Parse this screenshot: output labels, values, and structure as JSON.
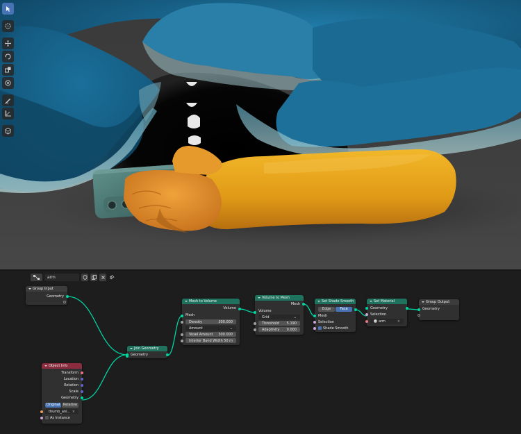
{
  "viewport": {
    "toolbar": [
      {
        "icon": "select-box-icon",
        "active": true
      },
      {
        "icon": "cursor-icon",
        "active": false
      },
      {
        "icon": "move-icon",
        "active": false
      },
      {
        "icon": "rotate-icon",
        "active": false
      },
      {
        "icon": "scale-icon",
        "active": false
      },
      {
        "icon": "transform-icon",
        "active": false
      },
      {
        "icon": "annotate-icon",
        "active": false
      },
      {
        "icon": "measure-icon",
        "active": false
      },
      {
        "icon": "add-cube-icon",
        "active": false
      }
    ]
  },
  "node_editor": {
    "tree_name": "arm",
    "nodes": {
      "group_input": {
        "title": "Group Input",
        "geometry": "Geometry"
      },
      "object_info": {
        "title": "Object Info",
        "outputs": [
          "Transform",
          "Location",
          "Rotation",
          "Scale",
          "Geometry"
        ],
        "mode_original": "Original",
        "mode_relative": "Relative",
        "object": "thumb_ani...",
        "as_instance": "As Instance"
      },
      "join_geometry": {
        "title": "Join Geometry",
        "geometry": "Geometry"
      },
      "mesh_to_volume": {
        "title": "Mesh to Volume",
        "output": "Volume",
        "input": "Mesh",
        "density_label": "Density",
        "density": "300.000",
        "mode": "Amount",
        "voxel_label": "Voxel Amount",
        "voxel": "300.000",
        "band_label": "Interior Band Width",
        "band": "50 m"
      },
      "volume_to_mesh": {
        "title": "Volume to Mesh",
        "output": "Mesh",
        "input": "Volume",
        "mode": "Grid",
        "threshold_label": "Threshold",
        "threshold": "5.190",
        "adaptivity_label": "Adaptivity",
        "adaptivity": "0.000"
      },
      "set_shade_smooth": {
        "title": "Set Shade Smooth",
        "mode_edge": "Edge",
        "mode_face": "Face",
        "mesh": "Mesh",
        "selection": "Selection",
        "shade_smooth": "Shade Smooth"
      },
      "set_material": {
        "title": "Set Material",
        "geometry": "Geometry",
        "selection": "Selection",
        "material": "arm"
      },
      "group_output": {
        "title": "Group Output",
        "geometry": "Geometry"
      }
    }
  },
  "colors": {
    "geometry_header": "#1f735e",
    "input_header": "#8b2c3e",
    "group_header": "#3c3c3c",
    "link": "#00d6a3",
    "active_tool": "#4772b3",
    "arm": "#e6a21e"
  }
}
